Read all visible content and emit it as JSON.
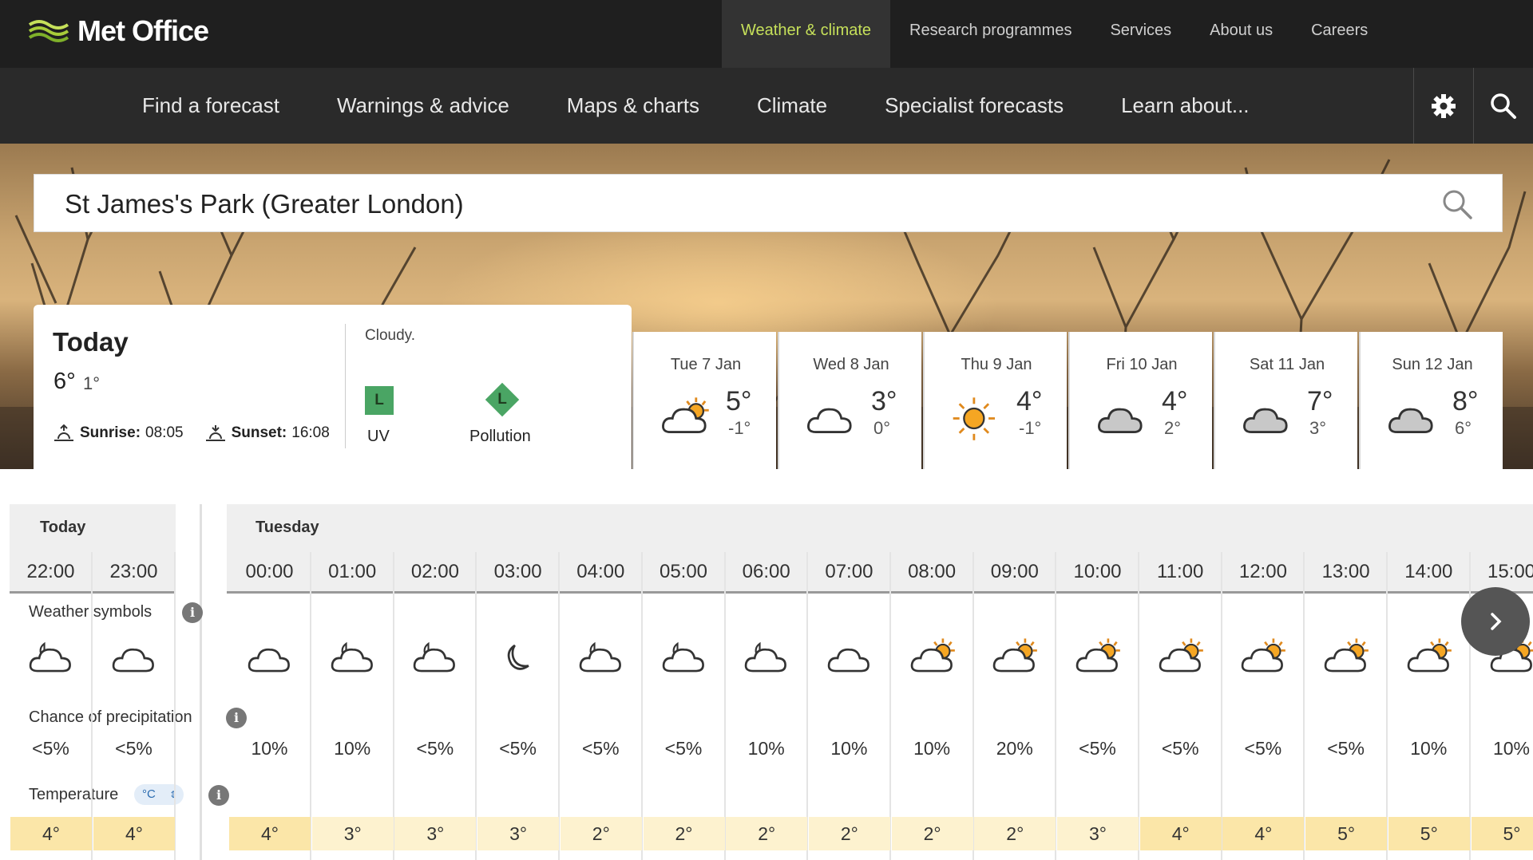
{
  "brand": {
    "name": "Met Office",
    "accent": "#c6e05a"
  },
  "top_nav": [
    {
      "label": "Weather & climate",
      "active": true
    },
    {
      "label": "Research programmes",
      "active": false
    },
    {
      "label": "Services",
      "active": false
    },
    {
      "label": "About us",
      "active": false
    },
    {
      "label": "Careers",
      "active": false
    }
  ],
  "main_nav": [
    "Find a forecast",
    "Warnings & advice",
    "Maps & charts",
    "Climate",
    "Specialist forecasts",
    "Learn about..."
  ],
  "icons": {
    "settings": "gear-icon",
    "search": "search-icon"
  },
  "search": {
    "value": "St James's Park (Greater London)"
  },
  "today": {
    "title": "Today",
    "high": "6°",
    "low": "1°",
    "sunrise_label": "Sunrise:",
    "sunrise": "08:05",
    "sunset_label": "Sunset:",
    "sunset": "16:08",
    "summary": "Cloudy.",
    "uv_level": "L",
    "uv_label": "UV",
    "pollution_level": "L",
    "pollution_label": "Pollution"
  },
  "days": [
    {
      "name": "Tue 7 Jan",
      "icon": "sunny-intervals-icon",
      "high": "5°",
      "low": "-1°"
    },
    {
      "name": "Wed 8 Jan",
      "icon": "cloud-icon",
      "high": "3°",
      "low": "0°"
    },
    {
      "name": "Thu 9 Jan",
      "icon": "sun-icon",
      "high": "4°",
      "low": "-1°"
    },
    {
      "name": "Fri 10 Jan",
      "icon": "overcast-icon",
      "high": "4°",
      "low": "2°"
    },
    {
      "name": "Sat 11 Jan",
      "icon": "overcast-icon",
      "high": "7°",
      "low": "3°"
    },
    {
      "name": "Sun 12 Jan",
      "icon": "overcast-icon",
      "high": "8°",
      "low": "6°"
    }
  ],
  "hourly": {
    "today_label": "Today",
    "tuesday_label": "Tuesday",
    "weather_symbols_label": "Weather symbols",
    "precip_label": "Chance of precipitation",
    "temperature_label": "Temperature",
    "unit": "°C",
    "hours": [
      {
        "time": "22:00",
        "icon": "partly-cloudy-night-icon",
        "precip": "<5%",
        "temp": "4°"
      },
      {
        "time": "23:00",
        "icon": "cloud-icon",
        "precip": "<5%",
        "temp": "4°"
      },
      {
        "time": "00:00",
        "icon": "cloud-icon",
        "precip": "10%",
        "temp": "4°"
      },
      {
        "time": "01:00",
        "icon": "partly-cloudy-night-icon",
        "precip": "10%",
        "temp": "3°"
      },
      {
        "time": "02:00",
        "icon": "partly-cloudy-night-icon",
        "precip": "<5%",
        "temp": "3°"
      },
      {
        "time": "03:00",
        "icon": "moon-icon",
        "precip": "<5%",
        "temp": "3°"
      },
      {
        "time": "04:00",
        "icon": "partly-cloudy-night-icon",
        "precip": "<5%",
        "temp": "2°"
      },
      {
        "time": "05:00",
        "icon": "partly-cloudy-night-icon",
        "precip": "<5%",
        "temp": "2°"
      },
      {
        "time": "06:00",
        "icon": "partly-cloudy-night-icon",
        "precip": "10%",
        "temp": "2°"
      },
      {
        "time": "07:00",
        "icon": "cloud-icon",
        "precip": "10%",
        "temp": "2°"
      },
      {
        "time": "08:00",
        "icon": "sunny-intervals-icon",
        "precip": "10%",
        "temp": "2°"
      },
      {
        "time": "09:00",
        "icon": "sunny-intervals-icon",
        "precip": "20%",
        "temp": "2°"
      },
      {
        "time": "10:00",
        "icon": "sunny-intervals-icon",
        "precip": "<5%",
        "temp": "3°"
      },
      {
        "time": "11:00",
        "icon": "sunny-intervals-icon",
        "precip": "<5%",
        "temp": "4°"
      },
      {
        "time": "12:00",
        "icon": "sunny-intervals-icon",
        "precip": "<5%",
        "temp": "4°"
      },
      {
        "time": "13:00",
        "icon": "sunny-intervals-icon",
        "precip": "<5%",
        "temp": "5°"
      },
      {
        "time": "14:00",
        "icon": "sunny-intervals-icon",
        "precip": "10%",
        "temp": "5°"
      },
      {
        "time": "15:00",
        "icon": "sunny-intervals-icon",
        "precip": "10%",
        "temp": "5°"
      }
    ]
  }
}
